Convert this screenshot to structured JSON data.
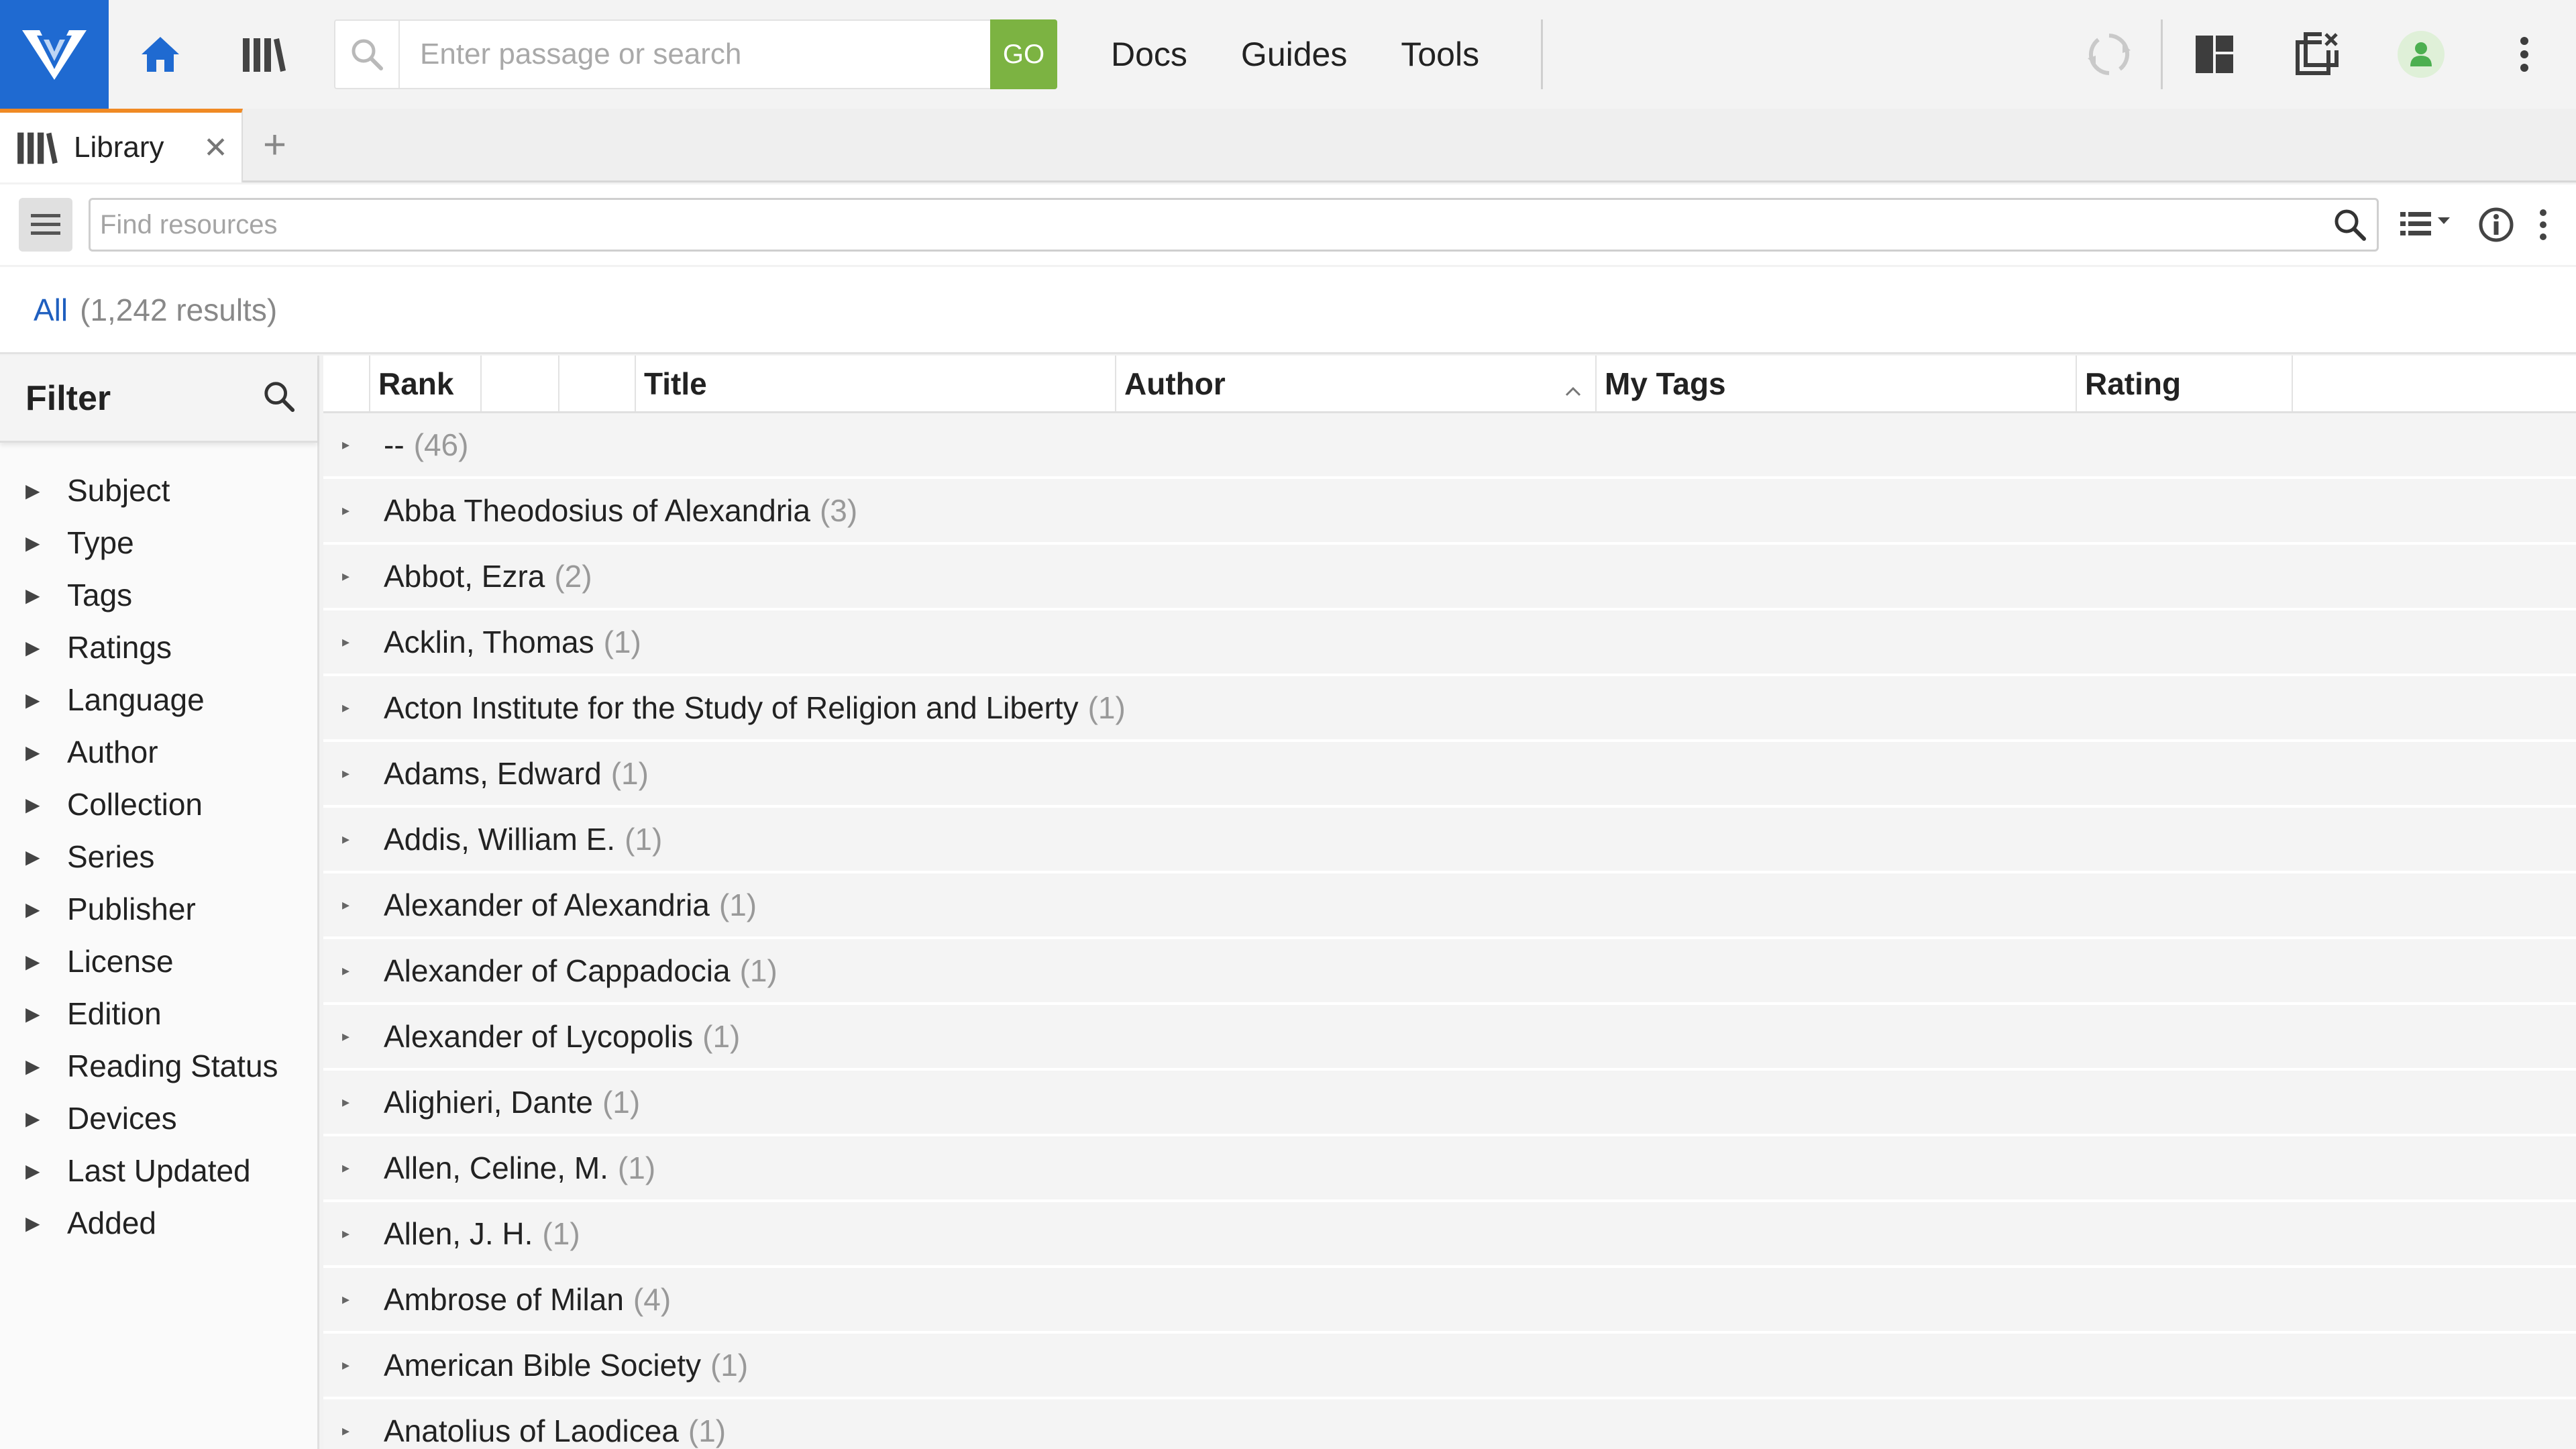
{
  "topbar": {
    "search_placeholder": "Enter passage or search",
    "go_label": "GO",
    "menu": [
      "Docs",
      "Guides",
      "Tools"
    ]
  },
  "tabs": {
    "active_label": "Library",
    "close_glyph": "✕",
    "add_glyph": "+"
  },
  "resources": {
    "find_placeholder": "Find resources"
  },
  "summary": {
    "all_label": "All",
    "count_text": "(1,242 results)"
  },
  "filter": {
    "title": "Filter",
    "items": [
      "Subject",
      "Type",
      "Tags",
      "Ratings",
      "Language",
      "Author",
      "Collection",
      "Series",
      "Publisher",
      "License",
      "Edition",
      "Reading Status",
      "Devices",
      "Last Updated",
      "Added"
    ]
  },
  "grid": {
    "columns": [
      "Rank",
      "",
      "",
      "Title",
      "Author",
      "My Tags",
      "Rating",
      ""
    ],
    "sorted_column": "Author",
    "groups": [
      {
        "name": "--",
        "count": "(46)"
      },
      {
        "name": "Abba Theodosius of Alexandria",
        "count": "(3)"
      },
      {
        "name": "Abbot, Ezra",
        "count": "(2)"
      },
      {
        "name": "Acklin, Thomas",
        "count": "(1)"
      },
      {
        "name": "Acton Institute for the Study of Religion and Liberty",
        "count": "(1)"
      },
      {
        "name": "Adams, Edward",
        "count": "(1)"
      },
      {
        "name": "Addis, William E.",
        "count": "(1)"
      },
      {
        "name": "Alexander of Alexandria",
        "count": "(1)"
      },
      {
        "name": "Alexander of Cappadocia",
        "count": "(1)"
      },
      {
        "name": "Alexander of Lycopolis",
        "count": "(1)"
      },
      {
        "name": "Alighieri, Dante",
        "count": "(1)"
      },
      {
        "name": "Allen, Celine, M.",
        "count": "(1)"
      },
      {
        "name": "Allen, J. H.",
        "count": "(1)"
      },
      {
        "name": "Ambrose of Milan",
        "count": "(4)"
      },
      {
        "name": "American Bible Society",
        "count": "(1)"
      },
      {
        "name": "Anatolius of Laodicea",
        "count": "(1)"
      }
    ]
  },
  "colors": {
    "brand_blue": "#1f6ad1",
    "go_green": "#7cb342",
    "tab_accent": "#f08a24",
    "link_blue": "#1f5fbf"
  },
  "icons": [
    "logos-logo-icon",
    "home-icon",
    "library-icon",
    "search-icon",
    "sync-icon",
    "layout-icon",
    "close-panels-icon",
    "user-icon",
    "more-vertical-icon",
    "hamburger-icon",
    "view-options-icon",
    "info-icon",
    "sort-ascending-icon"
  ]
}
